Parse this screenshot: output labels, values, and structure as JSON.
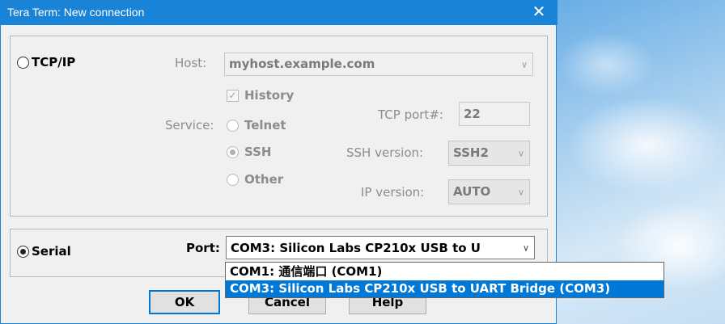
{
  "window": {
    "title": "Tera Term: New connection",
    "close_glyph": "✕"
  },
  "tcpip": {
    "radio_label": "TCP/IP",
    "host_label": "Host:",
    "host_value": "myhost.example.com",
    "history_label": "History",
    "service_label": "Service:",
    "telnet_label": "Telnet",
    "ssh_label": "SSH",
    "other_label": "Other",
    "tcp_port_label": "TCP port#:",
    "tcp_port_value": "22",
    "ssh_version_label": "SSH version:",
    "ssh_version_value": "SSH2",
    "ip_version_label": "IP version:",
    "ip_version_value": "AUTO"
  },
  "serial": {
    "radio_label": "Serial",
    "port_label": "Port:",
    "port_value": "COM3: Silicon Labs CP210x USB to U",
    "options": [
      "COM1: 通信端口 (COM1)",
      "COM3: Silicon Labs CP210x USB to UART Bridge (COM3)"
    ]
  },
  "buttons": {
    "ok": "OK",
    "cancel": "Cancel",
    "help": "Help"
  },
  "icons": {
    "chevron": "∨",
    "check": "✓"
  }
}
